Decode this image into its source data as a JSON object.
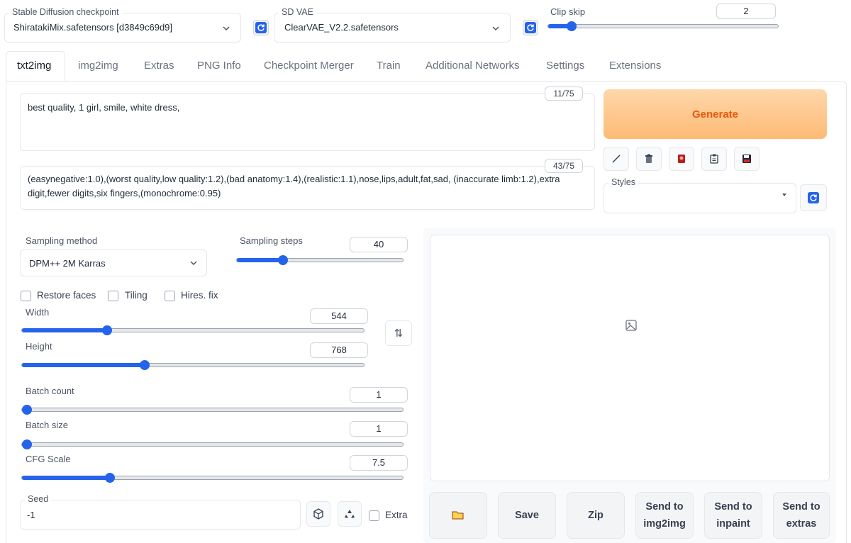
{
  "checkpoint": {
    "label": "Stable Diffusion checkpoint",
    "value": "ShiratakiMix.safetensors [d3849c69d9]"
  },
  "vae": {
    "label": "SD VAE",
    "value": "ClearVAE_V2.2.safetensors"
  },
  "clip_skip": {
    "label": "Clip skip",
    "value": "2",
    "level": 0.12
  },
  "tabs": [
    {
      "label": "txt2img",
      "active": true
    },
    {
      "label": "img2img"
    },
    {
      "label": "Extras"
    },
    {
      "label": "PNG Info"
    },
    {
      "label": "Checkpoint Merger"
    },
    {
      "label": "Train"
    },
    {
      "label": "Additional Networks"
    },
    {
      "label": "Settings"
    },
    {
      "label": "Extensions"
    }
  ],
  "prompt": {
    "text": "best quality, 1 girl, smile, white dress,",
    "counter": "11/75"
  },
  "negative_prompt": {
    "text": "(easynegative:1.0),(worst quality,low quality:1.2),(bad anatomy:1.4),(realistic:1.1),nose,lips,adult,fat,sad, (inaccurate limb:1.2),extra digit,fewer digits,six fingers,(monochrome:0.95)",
    "counter": "43/75"
  },
  "generate_label": "Generate",
  "styles_label": "Styles",
  "sampling": {
    "method_label": "Sampling method",
    "method_value": "DPM++ 2M Karras",
    "steps_label": "Sampling steps",
    "steps_value": "40"
  },
  "checkboxes": {
    "restore_faces": "Restore faces",
    "tiling": "Tiling",
    "hires_fix": "Hires. fix",
    "extra": "Extra"
  },
  "width": {
    "label": "Width",
    "value": "544"
  },
  "height": {
    "label": "Height",
    "value": "768"
  },
  "batch_count": {
    "label": "Batch count",
    "value": "1"
  },
  "batch_size": {
    "label": "Batch size",
    "value": "1"
  },
  "cfg_scale": {
    "label": "CFG Scale",
    "value": "7.5"
  },
  "seed": {
    "label": "Seed",
    "value": "-1"
  },
  "swap_icon": "⇅",
  "output_buttons": {
    "folder_icon": "folder-icon",
    "save": "Save",
    "zip": "Zip",
    "send_img2img_1": "Send to",
    "send_img2img_2": "img2img",
    "send_inpaint_1": "Send to",
    "send_inpaint_2": "inpaint",
    "send_extras_1": "Send to",
    "send_extras_2": "extras"
  },
  "colors": {
    "accent": "#2563eb",
    "generate_bg": "#fdba74",
    "generate_text": "#ea580c"
  }
}
